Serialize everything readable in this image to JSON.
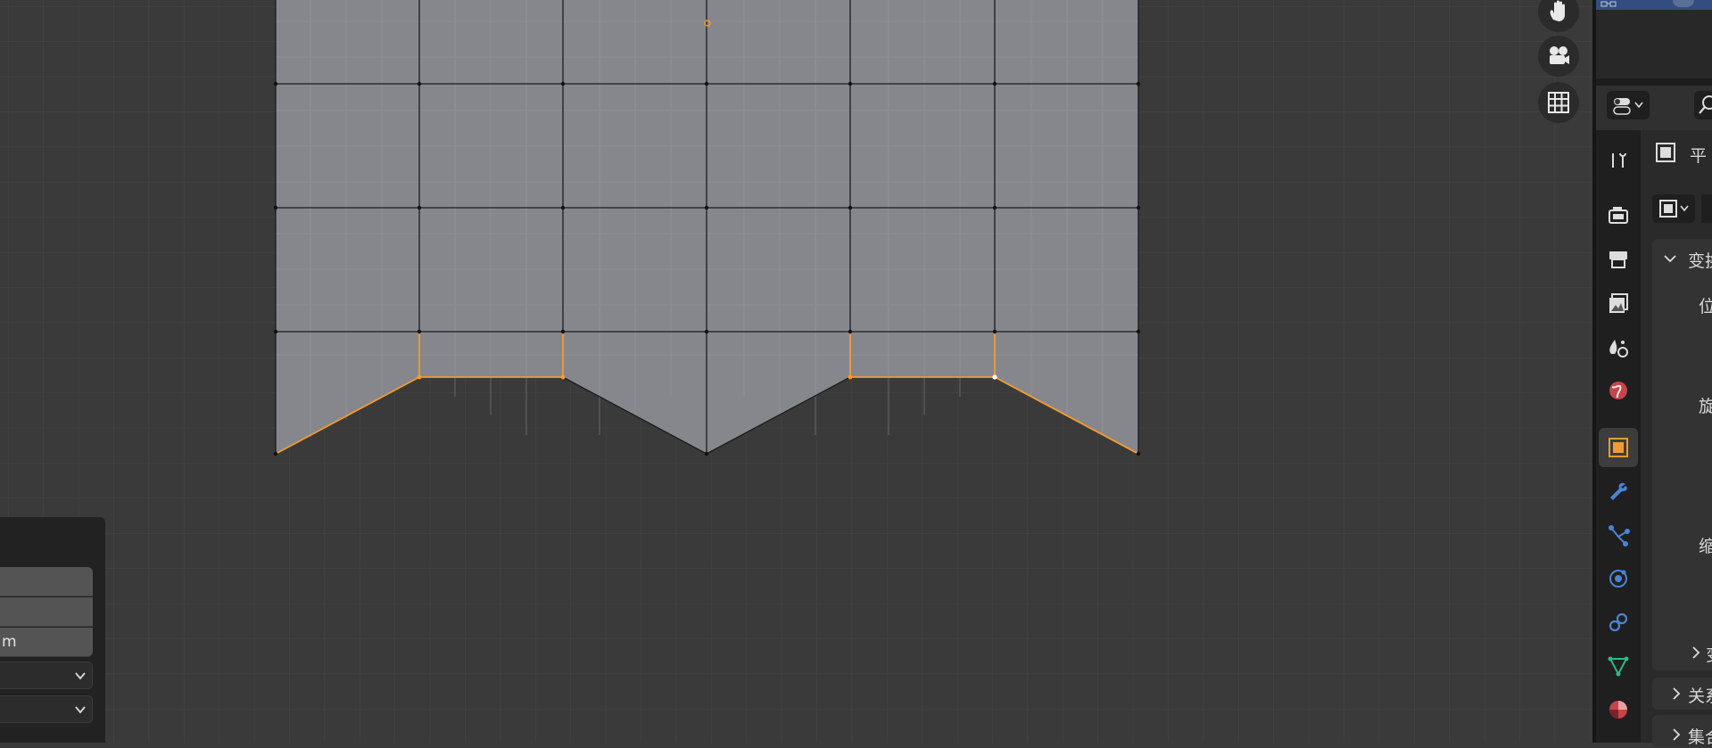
{
  "operator_panel": {
    "field_1": "",
    "field_2": "",
    "field_3": "m",
    "dropdown_1": "",
    "dropdown_2": ""
  },
  "navigation_gizmo": {
    "icons": [
      "hand-pan-icon",
      "camera-icon",
      "grid-toggle-icon"
    ]
  },
  "properties": {
    "object_name": "平",
    "sections": {
      "transform": "变换",
      "location": "位",
      "rotation": "旋",
      "scale": "缩",
      "delta_transform": "变",
      "relations": "关系",
      "collections": "集合"
    },
    "tabs": [
      "tool",
      "render",
      "output",
      "view-layer",
      "scene",
      "world",
      "object",
      "modifiers",
      "particles",
      "physics",
      "constraints",
      "data",
      "material"
    ],
    "active_tab": "object"
  },
  "colors": {
    "viewport_bg": "#3a3a3a",
    "mesh_face": "#86878d",
    "selection": "#f29b2f",
    "active_tab_icon": "#f29b2f",
    "outliner_selected": "#334d80"
  }
}
